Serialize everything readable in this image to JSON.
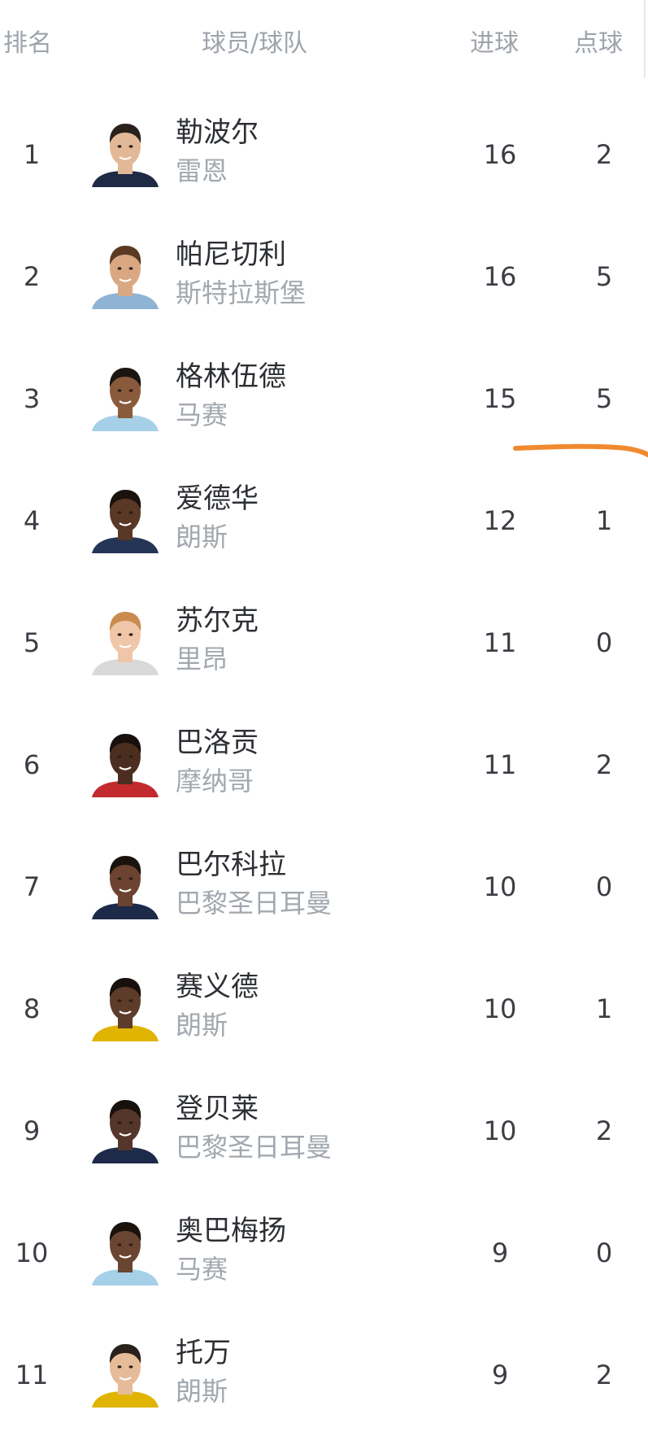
{
  "header": {
    "rank_label": "排名",
    "player_team_label": "球员/球队",
    "goals_label": "进球",
    "penalties_label": "点球"
  },
  "players": [
    {
      "rank": "1",
      "name": "勒波尔",
      "team": "雷恩",
      "goals": "16",
      "penalties": "2",
      "skin": "#e2b896",
      "hair": "#2a211c",
      "shirt": "#1f2a44"
    },
    {
      "rank": "2",
      "name": "帕尼切利",
      "team": "斯特拉斯堡",
      "goals": "16",
      "penalties": "5",
      "skin": "#d9a883",
      "hair": "#5a3a22",
      "shirt": "#8fb3d4"
    },
    {
      "rank": "3",
      "name": "格林伍德",
      "team": "马赛",
      "goals": "15",
      "penalties": "5",
      "skin": "#8a5a3c",
      "hair": "#1c1410",
      "shirt": "#a6d0e8"
    },
    {
      "rank": "4",
      "name": "爱德华",
      "team": "朗斯",
      "goals": "12",
      "penalties": "1",
      "skin": "#5a3826",
      "hair": "#1a120d",
      "shirt": "#243555"
    },
    {
      "rank": "5",
      "name": "苏尔克",
      "team": "里昂",
      "goals": "11",
      "penalties": "0",
      "skin": "#f0c6a8",
      "hair": "#c98b4e",
      "shirt": "#d9d9d9"
    },
    {
      "rank": "6",
      "name": "巴洛贡",
      "team": "摩纳哥",
      "goals": "11",
      "penalties": "2",
      "skin": "#4c2e20",
      "hair": "#17100c",
      "shirt": "#c22a2e"
    },
    {
      "rank": "7",
      "name": "巴尔科拉",
      "team": "巴黎圣日耳曼",
      "goals": "10",
      "penalties": "0",
      "skin": "#6b4330",
      "hair": "#1a120d",
      "shirt": "#1d2a4a"
    },
    {
      "rank": "8",
      "name": "赛义德",
      "team": "朗斯",
      "goals": "10",
      "penalties": "1",
      "skin": "#5e3c2a",
      "hair": "#17100c",
      "shirt": "#e0b400"
    },
    {
      "rank": "9",
      "name": "登贝莱",
      "team": "巴黎圣日耳曼",
      "goals": "10",
      "penalties": "2",
      "skin": "#55362a",
      "hair": "#17100c",
      "shirt": "#1d2a4a"
    },
    {
      "rank": "10",
      "name": "奥巴梅扬",
      "team": "马赛",
      "goals": "9",
      "penalties": "0",
      "skin": "#6a4632",
      "hair": "#1a120d",
      "shirt": "#a6d0e8"
    },
    {
      "rank": "11",
      "name": "托万",
      "team": "朗斯",
      "goals": "9",
      "penalties": "2",
      "skin": "#e6bb98",
      "hair": "#2a211c",
      "shirt": "#e0b400"
    }
  ],
  "colors": {
    "header_text": "#9ea4ab",
    "primary_text": "#2c2f33",
    "secondary_text": "#a2a8ae",
    "annotation_stroke": "#f08a2e"
  }
}
